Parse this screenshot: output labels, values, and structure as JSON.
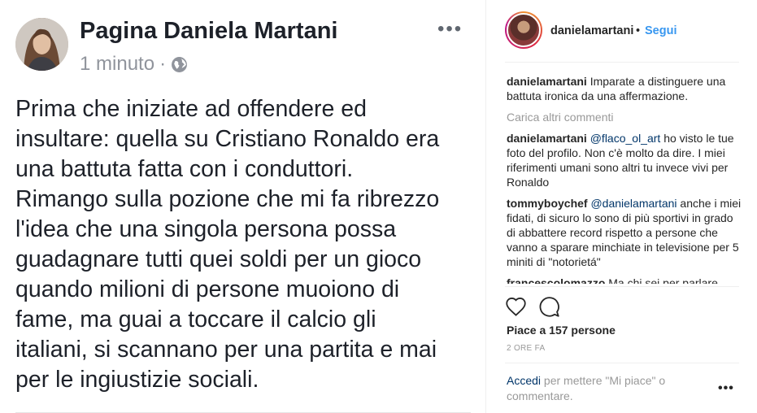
{
  "facebook": {
    "page_name": "Pagina Daniela Martani",
    "timestamp": "1 minuto",
    "separator": "·",
    "more_icon": "ellipsis-icon",
    "privacy_icon": "globe-icon",
    "body_lines": [
      "Prima che iniziate ad offendere ed",
      "insultare: quella su Cristiano Ronaldo era",
      "una battuta fatta con i conduttori.",
      "Rimango sulla pozione che mi fa ribrezzo",
      "l'idea che una singola persona possa",
      "guadagnare tutti quei soldi per un gioco",
      "quando milioni di persone muoiono di",
      "fame, ma guai a toccare il calcio gli",
      "italiani, si scannano per una partita e mai",
      "per le ingiustizie sociali."
    ]
  },
  "instagram": {
    "username": "danielamartani",
    "separator": "•",
    "follow_label": "Segui",
    "caption": {
      "user": "danielamartani",
      "text": "Imparate a distinguere una battuta ironica da una affermazione."
    },
    "load_more": "Carica altri commenti",
    "comments": [
      {
        "user": "danielamartani",
        "mention": "@flaco_ol_art",
        "text": "ho visto le tue foto del profilo. Non c'è molto da dire. I miei riferimenti umani sono altri tu invece vivi per Ronaldo"
      },
      {
        "user": "tommyboychef",
        "mention": "@danielamartani",
        "text": "anche i miei fidati, di sicuro lo sono di più sportivi in grado di abbattere record rispetto a persone che vanno a sparare minchiate in televisione per 5 miniti di \"notorietá\""
      },
      {
        "user": "francescolomazzo",
        "mention": "",
        "text": "Ma chi sei per parlare"
      }
    ],
    "likes": "Piace a 157 persone",
    "time_ago": "2 ORE FA",
    "login_link": "Accedi",
    "login_text": "per mettere \"Mi piace\" o commentare.",
    "icons": {
      "like": "heart-icon",
      "comment": "comment-icon",
      "more": "ellipsis-icon"
    },
    "colors": {
      "link": "#3897f0",
      "mention": "#003569",
      "muted": "#999999"
    }
  }
}
